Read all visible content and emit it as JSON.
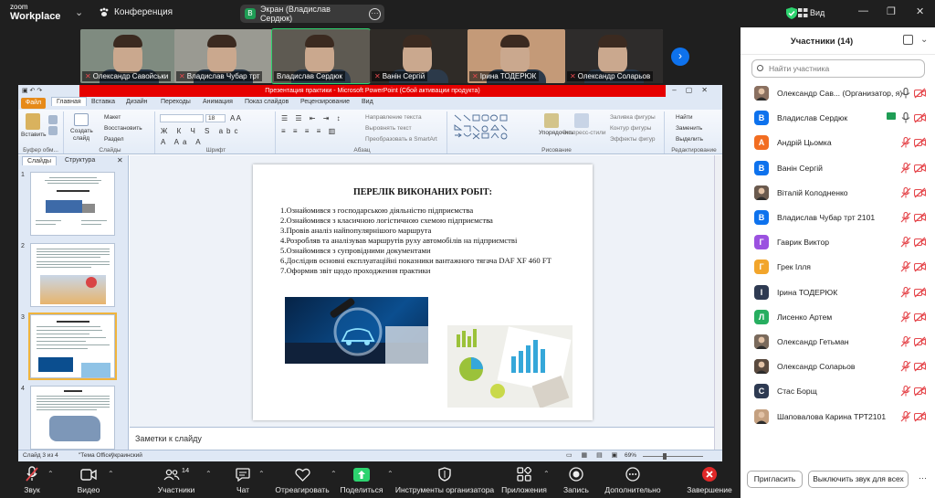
{
  "app": {
    "logo_top": "zoom",
    "logo_bottom": "Workplace",
    "conference": "Конференция",
    "share_pill": "Экран (Владислав Сердюк)",
    "share_badge": "В",
    "view": "Вид"
  },
  "thumbs": [
    {
      "name": "Олександр Савойськи",
      "muted": true,
      "bg": "#7f8b80"
    },
    {
      "name": "Владислав Чубар трт",
      "muted": true,
      "bg": "#9a9a92"
    },
    {
      "name": "Владислав Сердюк",
      "muted": false,
      "bg": "#5e5a52"
    },
    {
      "name": "Ванін Сергій",
      "muted": true,
      "bg": "#2f2b27"
    },
    {
      "name": "Ірина ТОДЕРЮК",
      "muted": true,
      "bg": "#c49a78"
    },
    {
      "name": "Олександр Соларьов",
      "muted": true,
      "bg": "#2e2c2b"
    }
  ],
  "ppt": {
    "window_title": "Презентация практики - Microsoft PowerPoint (Сбой активации продукта)",
    "tabs": {
      "file": "Файл",
      "home": "Главная",
      "insert": "Вставка",
      "design": "Дизайн",
      "transitions": "Переходы",
      "animation": "Анимация",
      "slideshow": "Показ слайдов",
      "review": "Рецензирование",
      "view": "Вид"
    },
    "ribbon": {
      "paste": "Вставить",
      "clipboard": "Буфер обм...",
      "create_slide": "Создать",
      "create_slide2": "слайд",
      "layout": "Макет",
      "restore": "Восстановить",
      "section": "Раздел",
      "slides_grp": "Слайды",
      "font_grp": "Шрифт",
      "font_size": "18",
      "text_dir": "Направление текста",
      "align_text": "Выровнять текст",
      "smartart": "Преобразовать в SmartArt",
      "paragraph_grp": "Абзац",
      "arrange": "Упорядочить",
      "quick_styles": "Экспресс-стили",
      "fill": "Заливка фигуры",
      "outline": "Контур фигуры",
      "effects": "Эффекты фигур",
      "drawing_grp": "Рисование",
      "find": "Найти",
      "replace": "Заменить",
      "select": "Выделить",
      "editing_grp": "Редактирование"
    },
    "left_tabs": {
      "slides": "Слайды",
      "structure": "Структура"
    },
    "slide_numbers": [
      "1",
      "2",
      "3",
      "4"
    ],
    "slide_title": "ПЕРЕЛІК ВИКОНАНИХ РОБІТ:",
    "slide_items": [
      "1.Ознайомився з господарською діяльністю підприємства",
      "2.Ознайомився з класичною логістичною схемою підприємства",
      "3.Провів аналіз найпопулярнішого маршрута",
      "4.Розробляв та аналізував маршрутів руху автомобілів на підприємстві",
      "5.Ознайомився з супровідними документами",
      "6.Дослідив основні експлуатаційні показники вантажного тягача DAF XF 460 FT",
      "7.Оформив звіт щодо проходження практики"
    ],
    "notes": "Заметки к слайду",
    "status": {
      "slide": "Слайд 3 из 4",
      "theme": "\"Тема Office\"",
      "lang": "украинский",
      "zoom": "69%"
    }
  },
  "panel": {
    "title": "Участники (14)",
    "search_placeholder": "Найти участника",
    "invite": "Пригласить",
    "mute_all": "Выключить звук для всех"
  },
  "participants": [
    {
      "name": "Олександр Сав... (Организатор, я)",
      "initial": "",
      "color": "#8a7060",
      "photo": true,
      "mic": "on",
      "cam": "off",
      "share": false
    },
    {
      "name": "Владислав Сердюк",
      "initial": "В",
      "color": "#0e72ed",
      "photo": false,
      "mic": "on",
      "cam": "off",
      "share": true
    },
    {
      "name": "Андрій Цьомка",
      "initial": "А",
      "color": "#f26d21",
      "photo": false,
      "mic": "muted",
      "cam": "off",
      "share": false
    },
    {
      "name": "Ванін Сергій",
      "initial": "В",
      "color": "#0e72ed",
      "photo": false,
      "mic": "muted",
      "cam": "off",
      "share": false
    },
    {
      "name": "Віталій Колодненко",
      "initial": "",
      "color": "#6a5a4e",
      "photo": true,
      "mic": "muted",
      "cam": "off",
      "share": false
    },
    {
      "name": "Владислав Чубар трт 2101",
      "initial": "В",
      "color": "#0e72ed",
      "photo": false,
      "mic": "muted",
      "cam": "off",
      "share": false
    },
    {
      "name": "Гаврик Виктор",
      "initial": "Г",
      "color": "#9b51e0",
      "photo": false,
      "mic": "muted",
      "cam": "off",
      "share": false
    },
    {
      "name": "Грек Ілля",
      "initial": "Г",
      "color": "#f2a52b",
      "photo": false,
      "mic": "muted",
      "cam": "off",
      "share": false
    },
    {
      "name": "Ірина ТОДЕРЮК",
      "initial": "І",
      "color": "#2e3a52",
      "photo": false,
      "mic": "muted",
      "cam": "off",
      "share": false
    },
    {
      "name": "Лисенко Артем",
      "initial": "Л",
      "color": "#27ae60",
      "photo": false,
      "mic": "muted",
      "cam": "off",
      "share": false
    },
    {
      "name": "Олександр Гетьман",
      "initial": "",
      "color": "#7a6a5c",
      "photo": true,
      "mic": "muted",
      "cam": "off",
      "share": false
    },
    {
      "name": "Олександр Соларьов",
      "initial": "",
      "color": "#5a4a3e",
      "photo": true,
      "mic": "muted",
      "cam": "off",
      "share": false
    },
    {
      "name": "Стас Борщ",
      "initial": "С",
      "color": "#2e3a52",
      "photo": false,
      "mic": "muted",
      "cam": "off",
      "share": false
    },
    {
      "name": "Шаповалова Карина ТРТ2101",
      "initial": "",
      "color": "#c4a080",
      "photo": true,
      "mic": "muted",
      "cam": "off",
      "share": false
    }
  ],
  "toolbar": {
    "audio": "Звук",
    "video": "Видео",
    "participants": "Участники",
    "participants_count": "14",
    "chat": "Чат",
    "react": "Отреагировать",
    "share": "Поделиться",
    "host_tools": "Инструменты организатора",
    "apps": "Приложения",
    "record": "Запись",
    "more": "Дополнительно",
    "end": "Завершение"
  },
  "colors": {
    "accent": "#0e72ed",
    "muted": "#e5484d",
    "share_green": "#2dd36f",
    "end_red": "#e02828"
  }
}
